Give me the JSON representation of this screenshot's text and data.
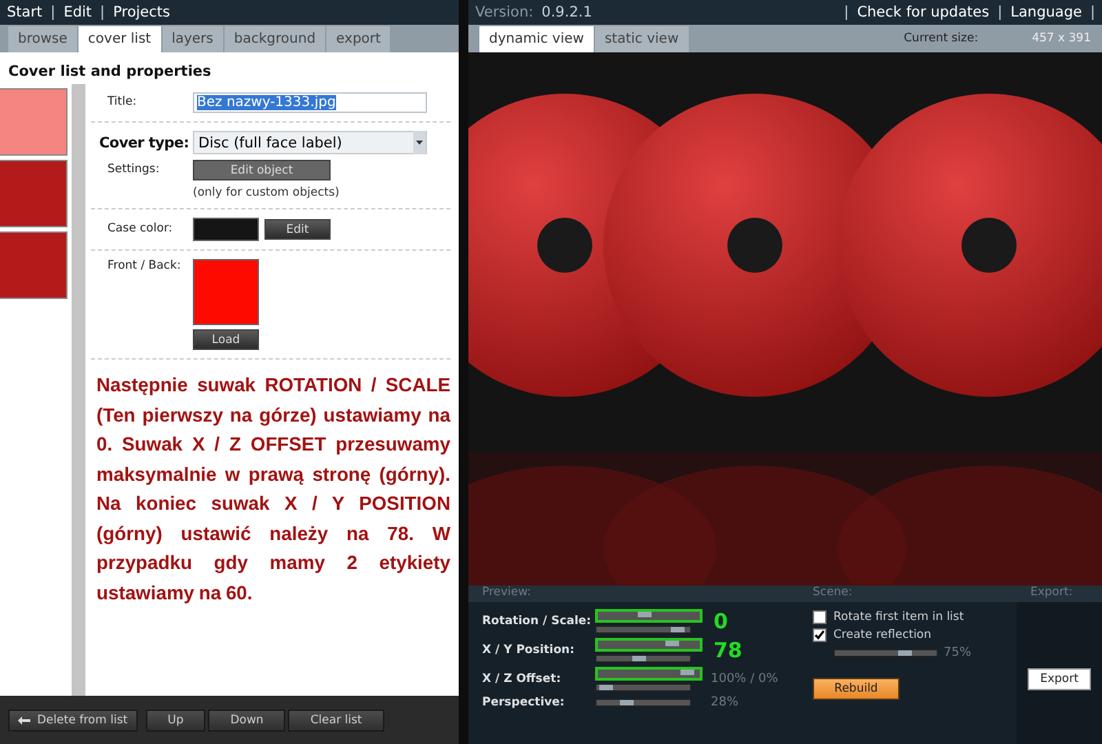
{
  "menu": [
    {
      "label": "Start",
      "kind": "item"
    },
    {
      "label": "|",
      "kind": "separator"
    },
    {
      "label": "Edit",
      "kind": "item"
    },
    {
      "label": "|",
      "kind": "separator"
    },
    {
      "label": "Projects",
      "kind": "item"
    }
  ],
  "left_tabs": [
    {
      "label": "browse",
      "selected": false
    },
    {
      "label": "cover list",
      "selected": true
    },
    {
      "label": "layers",
      "selected": false
    },
    {
      "label": "background",
      "selected": false
    },
    {
      "label": "export",
      "selected": false
    }
  ],
  "heading": "Cover list and properties",
  "covers": [
    {
      "selected": true
    },
    {
      "selected": false
    },
    {
      "selected": false
    }
  ],
  "form": {
    "title_label": "Title:",
    "title_value": "Bez nazwy-1333.jpg",
    "cover_type_label": "Cover type:",
    "cover_type_value": "Disc (full face label)",
    "settings_label": "Settings:",
    "settings_button": "Edit object",
    "settings_note": "(only for custom objects)",
    "case_color_label": "Case color:",
    "case_color_button": "Edit",
    "front_back_label": "Front / Back:",
    "load_button": "Load"
  },
  "instruction": "Następnie suwak ROTATION / SCALE (Ten pierwszy na górze) ustawiamy na 0. Suwak X / Z OFFSET przesuwamy maksymalnie w prawą stronę (górny). Na koniec suwak X / Y POSITION (górny) ustawić należy na 78. W przypadku gdy mamy 2 etykiety ustawiamy  na 60.",
  "bottom_buttons": [
    {
      "label": "Delete from list",
      "kind": "arrow"
    },
    {
      "label": "Up",
      "kind": "plain"
    },
    {
      "label": "Down",
      "kind": "plain"
    },
    {
      "label": "Clear list",
      "kind": "plain"
    }
  ],
  "version_label": "Version:",
  "version": "0.9.2.1",
  "top_links": [
    {
      "label": "|",
      "kind": "separator"
    },
    {
      "label": "Check for updates",
      "kind": "item"
    },
    {
      "label": "|",
      "kind": "separator"
    },
    {
      "label": "Language",
      "kind": "item"
    },
    {
      "label": "|",
      "kind": "separator"
    }
  ],
  "view_tabs": [
    {
      "label": "dynamic view",
      "selected": true
    },
    {
      "label": "static view",
      "selected": false
    }
  ],
  "size_label": "Current size:",
  "size": "457 x 391",
  "preview": {
    "kind": "picture"
  },
  "sections": [
    "Preview:",
    "Scene:",
    "Export:"
  ],
  "sliders": [
    {
      "label": "Rotation / Scale:",
      "reading": "0",
      "annotated": true,
      "tracks": [
        {
          "level": 0.45,
          "highlighted": true
        },
        {
          "level": 0.93,
          "highlighted": false
        }
      ]
    },
    {
      "label": "X / Y Position:",
      "reading": "78",
      "annotated": true,
      "tracks": [
        {
          "level": 0.76,
          "highlighted": true
        },
        {
          "level": 0.45,
          "highlighted": false
        }
      ]
    },
    {
      "label": "X / Z Offset:",
      "reading": "100% / 0%",
      "annotated": false,
      "tracks": [
        {
          "level": 0.93,
          "highlighted": true
        },
        {
          "level": 0.04,
          "highlighted": false
        }
      ]
    },
    {
      "label": "Perspective:",
      "reading": "28%",
      "annotated": false,
      "tracks": [
        {
          "level": 0.3,
          "highlighted": false
        }
      ]
    }
  ],
  "scene": {
    "options": [
      {
        "label": "Rotate first item in list",
        "checked": false
      },
      {
        "label": "Create reflection",
        "checked": true
      }
    ],
    "reflection": {
      "level": 0.72,
      "reading": "75%"
    },
    "rebuild_button": "Rebuild"
  },
  "export_button": "Export"
}
